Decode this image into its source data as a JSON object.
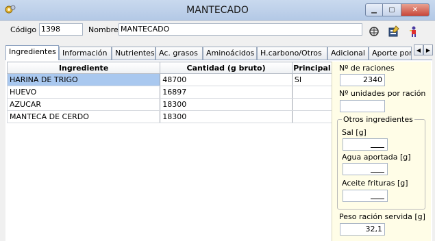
{
  "window": {
    "title": "MANTECADO",
    "app_icon": "gear-icon",
    "controls": [
      "minimize-icon",
      "maximize-icon",
      "close-icon"
    ]
  },
  "header": {
    "codigo_label": "Código",
    "codigo_value": "1398",
    "nombre_label": "Nombre",
    "nombre_value": "MANTECADO",
    "tools": [
      "recipe-icon",
      "edit-document-icon",
      "person-icon"
    ]
  },
  "tabs": [
    {
      "label": "Ingredientes",
      "active": true
    },
    {
      "label": "Información",
      "active": false
    },
    {
      "label": "Nutrientes",
      "active": false
    },
    {
      "label": "Ac. grasos",
      "active": false
    },
    {
      "label": "Aminoácidos",
      "active": false
    },
    {
      "label": "H.carbono/Otros",
      "active": false
    },
    {
      "label": "Adicional",
      "active": false
    },
    {
      "label": "Aporte por a",
      "active": false
    }
  ],
  "table": {
    "columns": [
      "Ingrediente",
      "Cantidad (g bruto)",
      "Principal"
    ],
    "rows": [
      {
        "ingrediente": "HARINA DE TRIGO",
        "cantidad": "48700",
        "principal": "SI"
      },
      {
        "ingrediente": "HUEVO",
        "cantidad": "16897",
        "principal": ""
      },
      {
        "ingrediente": "AZUCAR",
        "cantidad": "18300",
        "principal": ""
      },
      {
        "ingrediente": "MANTECA DE CERDO",
        "cantidad": "18300",
        "principal": ""
      }
    ]
  },
  "side": {
    "raciones_label": "Nº de raciones",
    "raciones_value": "2340",
    "unidades_label": "Nº unidades por ración",
    "unidades_value": "",
    "otros_title": "Otros ingredientes",
    "sal_label": "Sal [g]",
    "agua_label": "Agua aportada [g]",
    "aceite_label": "Aceite frituras [g]",
    "peso_label": "Peso ración servida [g]",
    "peso_value": "32,1"
  }
}
